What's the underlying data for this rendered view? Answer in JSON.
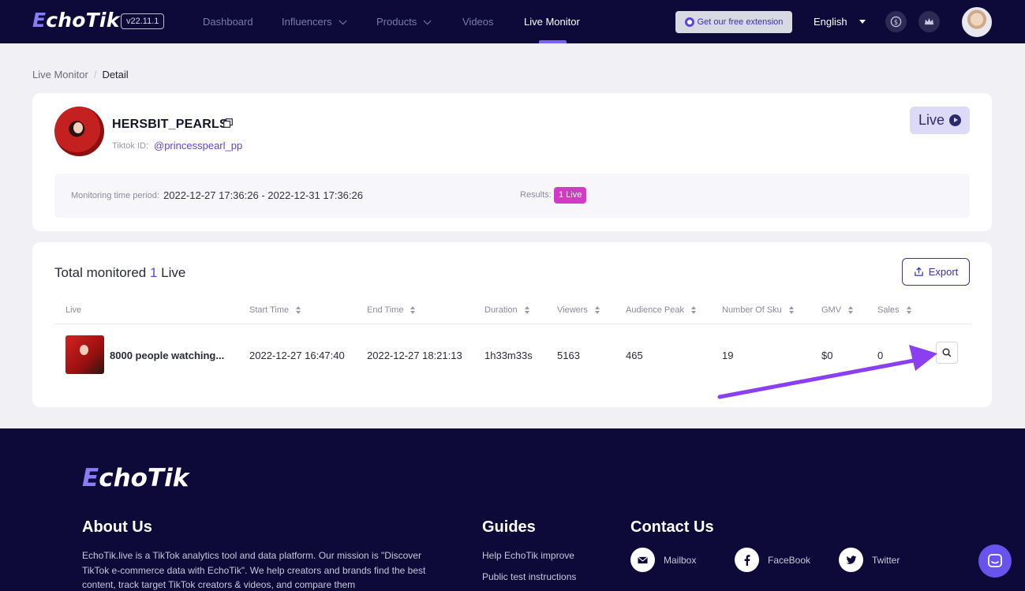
{
  "nav": {
    "logo_e": "E",
    "logo_rest": "choTik",
    "version": "v22.11.1",
    "items": [
      {
        "label": "Dashboard"
      },
      {
        "label": "Influencers"
      },
      {
        "label": "Products"
      },
      {
        "label": "Videos"
      },
      {
        "label": "Live Monitor"
      }
    ],
    "extension_label": "Get our free extension",
    "language": "English"
  },
  "breadcrumb": {
    "parent": "Live Monitor",
    "separator": "/",
    "current": "Detail"
  },
  "profile": {
    "username": "HERSBIT_PEARLS",
    "tiktok_id_label": "Tiktok ID:",
    "tiktok_id": "@princesspearl_pp",
    "live_button": "Live",
    "period_label": "Monitoring time period:",
    "period_value": "2022-12-27 17:36:26 - 2022-12-31 17:36:26",
    "results_label": "Results:",
    "results_badge": "1 Live"
  },
  "table": {
    "total_prefix": "Total monitored",
    "total_count": "1",
    "total_suffix": "Live",
    "export_label": "Export",
    "headers": [
      "Live",
      "Start Time",
      "End Time",
      "Duration",
      "Viewers",
      "Audience Peak",
      "Number Of Sku",
      "GMV",
      "Sales"
    ],
    "rows": [
      {
        "title": "8000 people watching...",
        "start": "2022-12-27 16:47:40",
        "end": "2022-12-27 18:21:13",
        "duration": "1h33m33s",
        "viewers": "5163",
        "audience_peak": "465",
        "sku": "19",
        "gmv": "$0",
        "sales": "0"
      }
    ]
  },
  "footer": {
    "logo_e": "E",
    "logo_rest": "choTik",
    "about_title": "About Us",
    "about_text": "EchoTik.live is a TikTok analytics tool and data platform. Our mission is \"Discover TikTok e-commerce data with EchoTik\". We help creators and brands find the best content, track target TikTok creators & videos, and compare them",
    "guides_title": "Guides",
    "guides": [
      "Help EchoTik improve",
      "Public test instructions"
    ],
    "contact_title": "Contact Us",
    "contacts": [
      {
        "label": "Mailbox",
        "icon": "mail-icon"
      },
      {
        "label": "FaceBook",
        "icon": "facebook-icon"
      },
      {
        "label": "Twitter",
        "icon": "twitter-icon"
      }
    ]
  },
  "colors": {
    "nav_bg": "#0d0a3a",
    "accent": "#5b47d6",
    "badge": "#d33bc7",
    "annotation_arrow": "#8a3ff0"
  }
}
